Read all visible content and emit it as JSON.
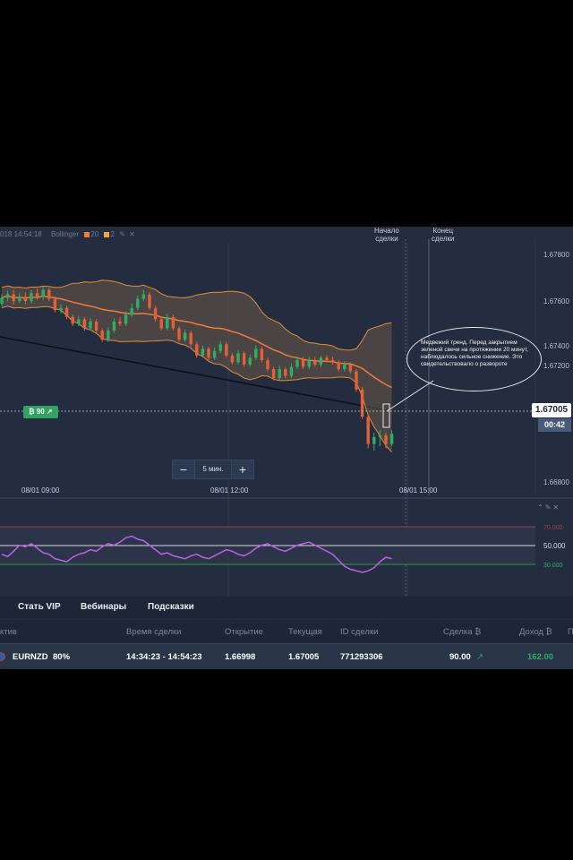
{
  "chart_info": {
    "datetime_fragment": "018 14:54:18",
    "indicator_name": "Bollinger",
    "period": "20",
    "deviation": "2",
    "indicator_colors": [
      "#f07a3c",
      "#f2a53a"
    ],
    "edit_icon": "pencil-icon",
    "close_icon": "close-icon"
  },
  "markers": {
    "start_line1": "Начало",
    "start_line2": "сделки",
    "end_line1": "Конец",
    "end_line2": "сделки"
  },
  "y_ticks": [
    "1.67800",
    "1.67600",
    "1.67400",
    "1.67200",
    "1.66800"
  ],
  "x_ticks": [
    "08/01 09:00",
    "08/01 12:00",
    "08/01 15:00"
  ],
  "current_price": "1.67005",
  "timer": "00:42",
  "bet_badge": "₿ 90 ↗",
  "timeframe": {
    "minus": "−",
    "value": "5 мин.",
    "plus": "+"
  },
  "annotation": "Медвежий тренд. Перед закрытием зеленой свечи на протяжении 20 минут, наблюдалось сильное снижение. Это свидетельствовало о развороте",
  "rsi": {
    "upper_label": "70.000",
    "mid_label": "50.000",
    "lower_label": "30.000"
  },
  "tabs": [
    "Стать VIP",
    "Вебинары",
    "Подсказки"
  ],
  "table": {
    "headers": [
      "ктив",
      "Время сделки",
      "Открытие",
      "Текущая",
      "ID сделки",
      "Сделка ₿",
      "Доход ₿",
      "П"
    ],
    "row": {
      "asset": "EURNZD",
      "payout": "80%",
      "time": "14:34:23 - 14:54:23",
      "open": "1.66998",
      "current": "1.67005",
      "id": "771293306",
      "amount": "90.00",
      "direction": "↗",
      "income": "162.00"
    }
  },
  "colors": {
    "bull": "#2fae63",
    "bear": "#e2603a",
    "band": "#e38d3a",
    "rsi": "#c15ee6",
    "background": "#232d3f"
  },
  "chart_data": {
    "type": "candlestick",
    "candles": [
      {
        "o": 1.67578,
        "c": 1.67605,
        "h": 1.6762,
        "l": 1.67565
      },
      {
        "o": 1.67605,
        "c": 1.6762,
        "h": 1.67635,
        "l": 1.6759
      },
      {
        "o": 1.6762,
        "c": 1.6759,
        "h": 1.6764,
        "l": 1.67575
      },
      {
        "o": 1.6759,
        "c": 1.6761,
        "h": 1.67625,
        "l": 1.6758
      },
      {
        "o": 1.6761,
        "c": 1.6759,
        "h": 1.67628,
        "l": 1.67575
      },
      {
        "o": 1.6759,
        "c": 1.67625,
        "h": 1.6764,
        "l": 1.6758
      },
      {
        "o": 1.67625,
        "c": 1.67608,
        "h": 1.67645,
        "l": 1.67595
      },
      {
        "o": 1.67608,
        "c": 1.6764,
        "h": 1.67655,
        "l": 1.67595
      },
      {
        "o": 1.6764,
        "c": 1.676,
        "h": 1.6765,
        "l": 1.6759
      },
      {
        "o": 1.676,
        "c": 1.6755,
        "h": 1.6761,
        "l": 1.6754
      },
      {
        "o": 1.6755,
        "c": 1.6756,
        "h": 1.67575,
        "l": 1.67535
      },
      {
        "o": 1.6756,
        "c": 1.6752,
        "h": 1.6757,
        "l": 1.6751
      },
      {
        "o": 1.6752,
        "c": 1.6749,
        "h": 1.6753,
        "l": 1.6748
      },
      {
        "o": 1.6749,
        "c": 1.6751,
        "h": 1.67525,
        "l": 1.6748
      },
      {
        "o": 1.6751,
        "c": 1.6747,
        "h": 1.6752,
        "l": 1.6746
      },
      {
        "o": 1.6747,
        "c": 1.675,
        "h": 1.67515,
        "l": 1.6746
      },
      {
        "o": 1.675,
        "c": 1.6746,
        "h": 1.6751,
        "l": 1.6745
      },
      {
        "o": 1.6746,
        "c": 1.6742,
        "h": 1.6747,
        "l": 1.6741
      },
      {
        "o": 1.6742,
        "c": 1.6746,
        "h": 1.67475,
        "l": 1.6741
      },
      {
        "o": 1.6746,
        "c": 1.675,
        "h": 1.67515,
        "l": 1.6745
      },
      {
        "o": 1.675,
        "c": 1.6749,
        "h": 1.6752,
        "l": 1.6748
      },
      {
        "o": 1.6749,
        "c": 1.6753,
        "h": 1.67545,
        "l": 1.6748
      },
      {
        "o": 1.6753,
        "c": 1.6756,
        "h": 1.6758,
        "l": 1.6752
      },
      {
        "o": 1.6756,
        "c": 1.676,
        "h": 1.67615,
        "l": 1.6755
      },
      {
        "o": 1.676,
        "c": 1.6762,
        "h": 1.6764,
        "l": 1.6759
      },
      {
        "o": 1.6762,
        "c": 1.6756,
        "h": 1.6763,
        "l": 1.6755
      },
      {
        "o": 1.6756,
        "c": 1.6751,
        "h": 1.6757,
        "l": 1.675
      },
      {
        "o": 1.6751,
        "c": 1.6747,
        "h": 1.6752,
        "l": 1.6746
      },
      {
        "o": 1.6747,
        "c": 1.6752,
        "h": 1.67535,
        "l": 1.6746
      },
      {
        "o": 1.6752,
        "c": 1.6747,
        "h": 1.6753,
        "l": 1.6746
      },
      {
        "o": 1.6747,
        "c": 1.6742,
        "h": 1.6748,
        "l": 1.6741
      },
      {
        "o": 1.6742,
        "c": 1.6745,
        "h": 1.67465,
        "l": 1.6741
      },
      {
        "o": 1.6745,
        "c": 1.674,
        "h": 1.6746,
        "l": 1.6739
      },
      {
        "o": 1.674,
        "c": 1.6735,
        "h": 1.6741,
        "l": 1.6734
      },
      {
        "o": 1.6735,
        "c": 1.6738,
        "h": 1.67395,
        "l": 1.6734
      },
      {
        "o": 1.6738,
        "c": 1.6734,
        "h": 1.6739,
        "l": 1.6733
      },
      {
        "o": 1.6734,
        "c": 1.6737,
        "h": 1.67385,
        "l": 1.6733
      },
      {
        "o": 1.6737,
        "c": 1.674,
        "h": 1.67415,
        "l": 1.6736
      },
      {
        "o": 1.674,
        "c": 1.6735,
        "h": 1.6741,
        "l": 1.6734
      },
      {
        "o": 1.6735,
        "c": 1.6732,
        "h": 1.6736,
        "l": 1.6731
      },
      {
        "o": 1.6732,
        "c": 1.6736,
        "h": 1.67375,
        "l": 1.6731
      },
      {
        "o": 1.6736,
        "c": 1.6731,
        "h": 1.6737,
        "l": 1.673
      },
      {
        "o": 1.6731,
        "c": 1.6734,
        "h": 1.67355,
        "l": 1.673
      },
      {
        "o": 1.6734,
        "c": 1.6738,
        "h": 1.67395,
        "l": 1.6733
      },
      {
        "o": 1.6738,
        "c": 1.6733,
        "h": 1.6739,
        "l": 1.6732
      },
      {
        "o": 1.6733,
        "c": 1.6729,
        "h": 1.6734,
        "l": 1.6728
      },
      {
        "o": 1.6729,
        "c": 1.6725,
        "h": 1.673,
        "l": 1.6724
      },
      {
        "o": 1.6725,
        "c": 1.6729,
        "h": 1.67305,
        "l": 1.6724
      },
      {
        "o": 1.6729,
        "c": 1.6726,
        "h": 1.673,
        "l": 1.6725
      },
      {
        "o": 1.6726,
        "c": 1.673,
        "h": 1.67315,
        "l": 1.6725
      },
      {
        "o": 1.673,
        "c": 1.6733,
        "h": 1.67345,
        "l": 1.6729
      },
      {
        "o": 1.6733,
        "c": 1.673,
        "h": 1.67345,
        "l": 1.6729
      },
      {
        "o": 1.673,
        "c": 1.6733,
        "h": 1.67345,
        "l": 1.6729
      },
      {
        "o": 1.6733,
        "c": 1.6731,
        "h": 1.67345,
        "l": 1.673
      },
      {
        "o": 1.6731,
        "c": 1.6734,
        "h": 1.6735,
        "l": 1.673
      },
      {
        "o": 1.6734,
        "c": 1.6733,
        "h": 1.6735,
        "l": 1.6732
      },
      {
        "o": 1.6733,
        "c": 1.6732,
        "h": 1.67345,
        "l": 1.6731
      },
      {
        "o": 1.6732,
        "c": 1.6729,
        "h": 1.6733,
        "l": 1.6728
      },
      {
        "o": 1.6729,
        "c": 1.6731,
        "h": 1.67325,
        "l": 1.6728
      },
      {
        "o": 1.6731,
        "c": 1.6728,
        "h": 1.6732,
        "l": 1.6727
      },
      {
        "o": 1.6728,
        "c": 1.672,
        "h": 1.6729,
        "l": 1.6719
      },
      {
        "o": 1.672,
        "c": 1.6708,
        "h": 1.6721,
        "l": 1.6707
      },
      {
        "o": 1.6708,
        "c": 1.6696,
        "h": 1.6709,
        "l": 1.6694
      },
      {
        "o": 1.6696,
        "c": 1.6699,
        "h": 1.6701,
        "l": 1.6693
      },
      {
        "o": 1.6699,
        "c": 1.66998,
        "h": 1.6702,
        "l": 1.6695
      },
      {
        "o": 1.66998,
        "c": 1.6696,
        "h": 1.6701,
        "l": 1.6694
      },
      {
        "o": 1.6696,
        "c": 1.67005,
        "h": 1.6702,
        "l": 1.6695
      }
    ],
    "ylim": [
      1.668,
      1.6785
    ],
    "x_axis_labels": [
      "08/01 09:00",
      "08/01 12:00",
      "08/01 15:00"
    ],
    "rsi_values": [
      48,
      45,
      52,
      60,
      58,
      62,
      56,
      50,
      48,
      42,
      40,
      38,
      44,
      48,
      50,
      54,
      52,
      58,
      62,
      60,
      64,
      70,
      72,
      68,
      66,
      60,
      54,
      48,
      50,
      46,
      44,
      42,
      46,
      48,
      44,
      42,
      46,
      50,
      54,
      52,
      48,
      46,
      50,
      56,
      60,
      62,
      58,
      54,
      52,
      56,
      60,
      62,
      64,
      60,
      56,
      52,
      48,
      40,
      32,
      28,
      26,
      24,
      26,
      30,
      38,
      44,
      42
    ],
    "rsi_levels": [
      70,
      50,
      30
    ]
  }
}
